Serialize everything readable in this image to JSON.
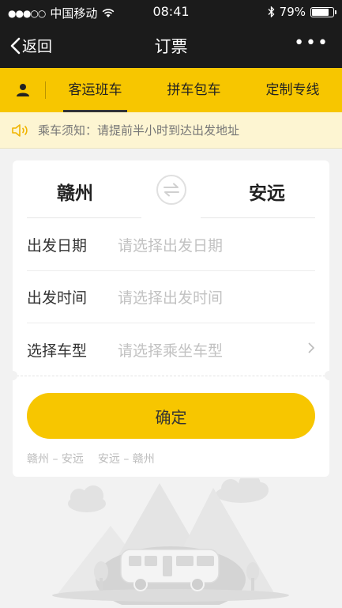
{
  "status_bar": {
    "carrier": "中国移动",
    "time": "08:41",
    "battery": "79%"
  },
  "nav": {
    "back_label": "返回",
    "title": "订票",
    "more": "•••"
  },
  "tabs": [
    {
      "label": "客运班车",
      "active": true
    },
    {
      "label": "拼车包车",
      "active": false
    },
    {
      "label": "定制专线",
      "active": false
    }
  ],
  "notice": {
    "text": "乘车须知：请提前半小时到达出发地址"
  },
  "route": {
    "from": "赣州",
    "to": "安远"
  },
  "form": {
    "date": {
      "label": "出发日期",
      "placeholder": "请选择出发日期"
    },
    "time": {
      "label": "出发时间",
      "placeholder": "请选择出发时间"
    },
    "vehicle": {
      "label": "选择车型",
      "placeholder": "请选择乘坐车型"
    }
  },
  "confirm_label": "确定",
  "history": [
    "赣州 – 安远",
    "安远 – 赣州"
  ],
  "colors": {
    "accent": "#f7c600",
    "dark": "#1b1b1b",
    "notice_bg": "#fdf5d2"
  }
}
